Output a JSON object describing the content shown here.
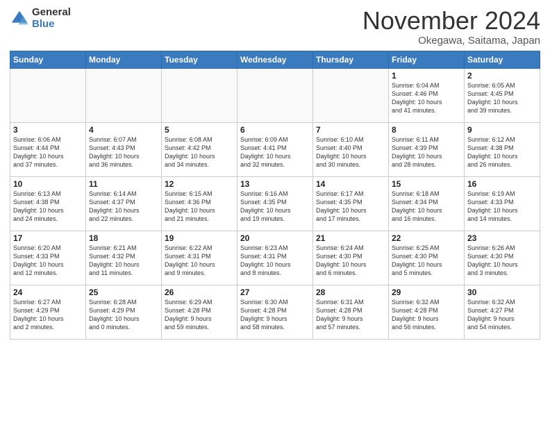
{
  "header": {
    "logo_general": "General",
    "logo_blue": "Blue",
    "title": "November 2024",
    "location": "Okegawa, Saitama, Japan"
  },
  "days_of_week": [
    "Sunday",
    "Monday",
    "Tuesday",
    "Wednesday",
    "Thursday",
    "Friday",
    "Saturday"
  ],
  "weeks": [
    [
      {
        "day": "",
        "info": ""
      },
      {
        "day": "",
        "info": ""
      },
      {
        "day": "",
        "info": ""
      },
      {
        "day": "",
        "info": ""
      },
      {
        "day": "",
        "info": ""
      },
      {
        "day": "1",
        "info": "Sunrise: 6:04 AM\nSunset: 4:46 PM\nDaylight: 10 hours\nand 41 minutes."
      },
      {
        "day": "2",
        "info": "Sunrise: 6:05 AM\nSunset: 4:45 PM\nDaylight: 10 hours\nand 39 minutes."
      }
    ],
    [
      {
        "day": "3",
        "info": "Sunrise: 6:06 AM\nSunset: 4:44 PM\nDaylight: 10 hours\nand 37 minutes."
      },
      {
        "day": "4",
        "info": "Sunrise: 6:07 AM\nSunset: 4:43 PM\nDaylight: 10 hours\nand 36 minutes."
      },
      {
        "day": "5",
        "info": "Sunrise: 6:08 AM\nSunset: 4:42 PM\nDaylight: 10 hours\nand 34 minutes."
      },
      {
        "day": "6",
        "info": "Sunrise: 6:09 AM\nSunset: 4:41 PM\nDaylight: 10 hours\nand 32 minutes."
      },
      {
        "day": "7",
        "info": "Sunrise: 6:10 AM\nSunset: 4:40 PM\nDaylight: 10 hours\nand 30 minutes."
      },
      {
        "day": "8",
        "info": "Sunrise: 6:11 AM\nSunset: 4:39 PM\nDaylight: 10 hours\nand 28 minutes."
      },
      {
        "day": "9",
        "info": "Sunrise: 6:12 AM\nSunset: 4:38 PM\nDaylight: 10 hours\nand 26 minutes."
      }
    ],
    [
      {
        "day": "10",
        "info": "Sunrise: 6:13 AM\nSunset: 4:38 PM\nDaylight: 10 hours\nand 24 minutes."
      },
      {
        "day": "11",
        "info": "Sunrise: 6:14 AM\nSunset: 4:37 PM\nDaylight: 10 hours\nand 22 minutes."
      },
      {
        "day": "12",
        "info": "Sunrise: 6:15 AM\nSunset: 4:36 PM\nDaylight: 10 hours\nand 21 minutes."
      },
      {
        "day": "13",
        "info": "Sunrise: 6:16 AM\nSunset: 4:35 PM\nDaylight: 10 hours\nand 19 minutes."
      },
      {
        "day": "14",
        "info": "Sunrise: 6:17 AM\nSunset: 4:35 PM\nDaylight: 10 hours\nand 17 minutes."
      },
      {
        "day": "15",
        "info": "Sunrise: 6:18 AM\nSunset: 4:34 PM\nDaylight: 10 hours\nand 16 minutes."
      },
      {
        "day": "16",
        "info": "Sunrise: 6:19 AM\nSunset: 4:33 PM\nDaylight: 10 hours\nand 14 minutes."
      }
    ],
    [
      {
        "day": "17",
        "info": "Sunrise: 6:20 AM\nSunset: 4:33 PM\nDaylight: 10 hours\nand 12 minutes."
      },
      {
        "day": "18",
        "info": "Sunrise: 6:21 AM\nSunset: 4:32 PM\nDaylight: 10 hours\nand 11 minutes."
      },
      {
        "day": "19",
        "info": "Sunrise: 6:22 AM\nSunset: 4:31 PM\nDaylight: 10 hours\nand 9 minutes."
      },
      {
        "day": "20",
        "info": "Sunrise: 6:23 AM\nSunset: 4:31 PM\nDaylight: 10 hours\nand 8 minutes."
      },
      {
        "day": "21",
        "info": "Sunrise: 6:24 AM\nSunset: 4:30 PM\nDaylight: 10 hours\nand 6 minutes."
      },
      {
        "day": "22",
        "info": "Sunrise: 6:25 AM\nSunset: 4:30 PM\nDaylight: 10 hours\nand 5 minutes."
      },
      {
        "day": "23",
        "info": "Sunrise: 6:26 AM\nSunset: 4:30 PM\nDaylight: 10 hours\nand 3 minutes."
      }
    ],
    [
      {
        "day": "24",
        "info": "Sunrise: 6:27 AM\nSunset: 4:29 PM\nDaylight: 10 hours\nand 2 minutes."
      },
      {
        "day": "25",
        "info": "Sunrise: 6:28 AM\nSunset: 4:29 PM\nDaylight: 10 hours\nand 0 minutes."
      },
      {
        "day": "26",
        "info": "Sunrise: 6:29 AM\nSunset: 4:28 PM\nDaylight: 9 hours\nand 59 minutes."
      },
      {
        "day": "27",
        "info": "Sunrise: 6:30 AM\nSunset: 4:28 PM\nDaylight: 9 hours\nand 58 minutes."
      },
      {
        "day": "28",
        "info": "Sunrise: 6:31 AM\nSunset: 4:28 PM\nDaylight: 9 hours\nand 57 minutes."
      },
      {
        "day": "29",
        "info": "Sunrise: 6:32 AM\nSunset: 4:28 PM\nDaylight: 9 hours\nand 56 minutes."
      },
      {
        "day": "30",
        "info": "Sunrise: 6:32 AM\nSunset: 4:27 PM\nDaylight: 9 hours\nand 54 minutes."
      }
    ]
  ]
}
